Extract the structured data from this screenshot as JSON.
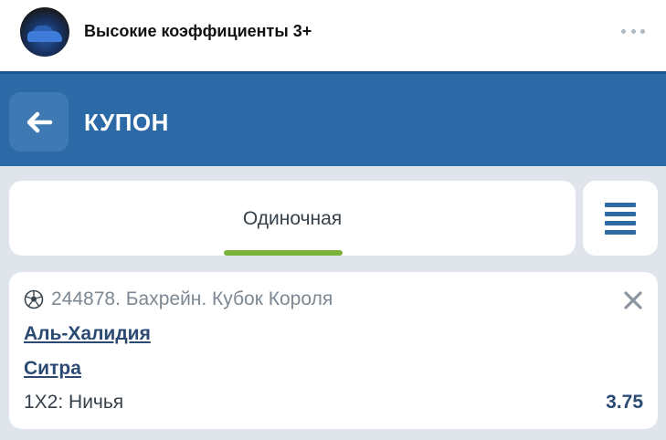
{
  "post": {
    "group_name": "Высокие коэффициенты 3+",
    "avatar_icon": "avatar-car-image",
    "more_icon": "more-horizontal-icon"
  },
  "header": {
    "back_icon": "arrow-left-icon",
    "title": "КУПОН",
    "background": "#2b6aa6"
  },
  "tabs": {
    "active_label": "Одиночная",
    "underline_color": "#7bb33d",
    "menu_icon": "hamburger-menu-icon"
  },
  "bet": {
    "sport_icon": "soccer-ball-icon",
    "event": "244878. Бахрейн. Кубок Короля",
    "team1": "Аль-Халидия",
    "team2": "Ситра",
    "market": "1X2: Ничья",
    "odds": "3.75",
    "close_icon": "close-icon"
  }
}
